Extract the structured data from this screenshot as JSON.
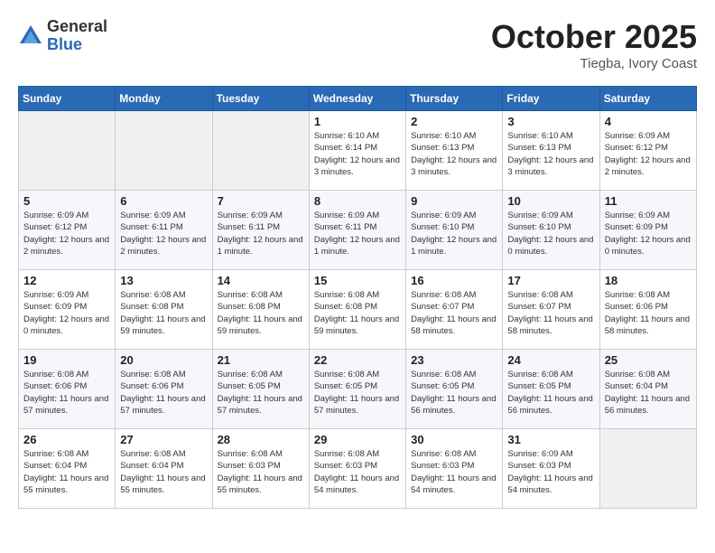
{
  "header": {
    "logo_general": "General",
    "logo_blue": "Blue",
    "month": "October 2025",
    "location": "Tiegba, Ivory Coast"
  },
  "days_of_week": [
    "Sunday",
    "Monday",
    "Tuesday",
    "Wednesday",
    "Thursday",
    "Friday",
    "Saturday"
  ],
  "weeks": [
    [
      {
        "day": "",
        "info": ""
      },
      {
        "day": "",
        "info": ""
      },
      {
        "day": "",
        "info": ""
      },
      {
        "day": "1",
        "info": "Sunrise: 6:10 AM\nSunset: 6:14 PM\nDaylight: 12 hours and 3 minutes."
      },
      {
        "day": "2",
        "info": "Sunrise: 6:10 AM\nSunset: 6:13 PM\nDaylight: 12 hours and 3 minutes."
      },
      {
        "day": "3",
        "info": "Sunrise: 6:10 AM\nSunset: 6:13 PM\nDaylight: 12 hours and 3 minutes."
      },
      {
        "day": "4",
        "info": "Sunrise: 6:09 AM\nSunset: 6:12 PM\nDaylight: 12 hours and 2 minutes."
      }
    ],
    [
      {
        "day": "5",
        "info": "Sunrise: 6:09 AM\nSunset: 6:12 PM\nDaylight: 12 hours and 2 minutes."
      },
      {
        "day": "6",
        "info": "Sunrise: 6:09 AM\nSunset: 6:11 PM\nDaylight: 12 hours and 2 minutes."
      },
      {
        "day": "7",
        "info": "Sunrise: 6:09 AM\nSunset: 6:11 PM\nDaylight: 12 hours and 1 minute."
      },
      {
        "day": "8",
        "info": "Sunrise: 6:09 AM\nSunset: 6:11 PM\nDaylight: 12 hours and 1 minute."
      },
      {
        "day": "9",
        "info": "Sunrise: 6:09 AM\nSunset: 6:10 PM\nDaylight: 12 hours and 1 minute."
      },
      {
        "day": "10",
        "info": "Sunrise: 6:09 AM\nSunset: 6:10 PM\nDaylight: 12 hours and 0 minutes."
      },
      {
        "day": "11",
        "info": "Sunrise: 6:09 AM\nSunset: 6:09 PM\nDaylight: 12 hours and 0 minutes."
      }
    ],
    [
      {
        "day": "12",
        "info": "Sunrise: 6:09 AM\nSunset: 6:09 PM\nDaylight: 12 hours and 0 minutes."
      },
      {
        "day": "13",
        "info": "Sunrise: 6:08 AM\nSunset: 6:08 PM\nDaylight: 11 hours and 59 minutes."
      },
      {
        "day": "14",
        "info": "Sunrise: 6:08 AM\nSunset: 6:08 PM\nDaylight: 11 hours and 59 minutes."
      },
      {
        "day": "15",
        "info": "Sunrise: 6:08 AM\nSunset: 6:08 PM\nDaylight: 11 hours and 59 minutes."
      },
      {
        "day": "16",
        "info": "Sunrise: 6:08 AM\nSunset: 6:07 PM\nDaylight: 11 hours and 58 minutes."
      },
      {
        "day": "17",
        "info": "Sunrise: 6:08 AM\nSunset: 6:07 PM\nDaylight: 11 hours and 58 minutes."
      },
      {
        "day": "18",
        "info": "Sunrise: 6:08 AM\nSunset: 6:06 PM\nDaylight: 11 hours and 58 minutes."
      }
    ],
    [
      {
        "day": "19",
        "info": "Sunrise: 6:08 AM\nSunset: 6:06 PM\nDaylight: 11 hours and 57 minutes."
      },
      {
        "day": "20",
        "info": "Sunrise: 6:08 AM\nSunset: 6:06 PM\nDaylight: 11 hours and 57 minutes."
      },
      {
        "day": "21",
        "info": "Sunrise: 6:08 AM\nSunset: 6:05 PM\nDaylight: 11 hours and 57 minutes."
      },
      {
        "day": "22",
        "info": "Sunrise: 6:08 AM\nSunset: 6:05 PM\nDaylight: 11 hours and 57 minutes."
      },
      {
        "day": "23",
        "info": "Sunrise: 6:08 AM\nSunset: 6:05 PM\nDaylight: 11 hours and 56 minutes."
      },
      {
        "day": "24",
        "info": "Sunrise: 6:08 AM\nSunset: 6:05 PM\nDaylight: 11 hours and 56 minutes."
      },
      {
        "day": "25",
        "info": "Sunrise: 6:08 AM\nSunset: 6:04 PM\nDaylight: 11 hours and 56 minutes."
      }
    ],
    [
      {
        "day": "26",
        "info": "Sunrise: 6:08 AM\nSunset: 6:04 PM\nDaylight: 11 hours and 55 minutes."
      },
      {
        "day": "27",
        "info": "Sunrise: 6:08 AM\nSunset: 6:04 PM\nDaylight: 11 hours and 55 minutes."
      },
      {
        "day": "28",
        "info": "Sunrise: 6:08 AM\nSunset: 6:03 PM\nDaylight: 11 hours and 55 minutes."
      },
      {
        "day": "29",
        "info": "Sunrise: 6:08 AM\nSunset: 6:03 PM\nDaylight: 11 hours and 54 minutes."
      },
      {
        "day": "30",
        "info": "Sunrise: 6:08 AM\nSunset: 6:03 PM\nDaylight: 11 hours and 54 minutes."
      },
      {
        "day": "31",
        "info": "Sunrise: 6:09 AM\nSunset: 6:03 PM\nDaylight: 11 hours and 54 minutes."
      },
      {
        "day": "",
        "info": ""
      }
    ]
  ]
}
